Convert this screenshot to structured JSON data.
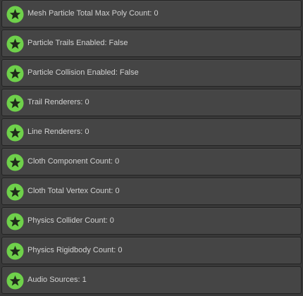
{
  "colors": {
    "background": "#383838",
    "row_background": "#454545",
    "row_border": "#242424",
    "badge_fill": "#6fd14b",
    "star_fill": "#1f2a1a",
    "text": "#d2d2d2"
  },
  "rows": [
    {
      "icon": "star-badge-icon",
      "text": "Mesh Particle Total Max Poly Count: 0"
    },
    {
      "icon": "star-badge-icon",
      "text": "Particle Trails Enabled: False"
    },
    {
      "icon": "star-badge-icon",
      "text": "Particle Collision Enabled: False"
    },
    {
      "icon": "star-badge-icon",
      "text": "Trail Renderers: 0"
    },
    {
      "icon": "star-badge-icon",
      "text": "Line Renderers: 0"
    },
    {
      "icon": "star-badge-icon",
      "text": "Cloth Component Count: 0"
    },
    {
      "icon": "star-badge-icon",
      "text": "Cloth Total Vertex Count: 0"
    },
    {
      "icon": "star-badge-icon",
      "text": "Physics Collider Count: 0"
    },
    {
      "icon": "star-badge-icon",
      "text": "Physics Rigidbody Count: 0"
    },
    {
      "icon": "star-badge-icon",
      "text": "Audio Sources: 1"
    }
  ]
}
